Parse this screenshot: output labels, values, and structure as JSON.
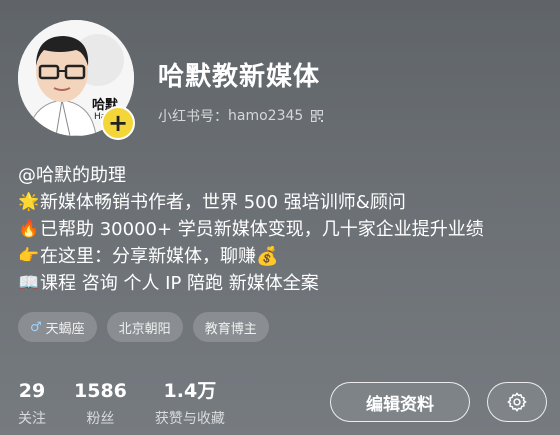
{
  "profile": {
    "name": "哈默教新媒体",
    "id_label": "小红书号：",
    "id_value": "hamo2345",
    "avatar_text": "哈默",
    "avatar_small": "Ha"
  },
  "bio": [
    {
      "icon": "✉",
      "text": "@哈默的助理",
      "icon_name": "none"
    },
    {
      "icon": "🌟",
      "text": "新媒体畅销书作者，世界 500 强培训师&顾问",
      "icon_name": "star-icon"
    },
    {
      "icon": "🔥",
      "text": "已帮助 30000+ 学员新媒体变现，几十家企业提升业绩",
      "icon_name": "fire-icon"
    },
    {
      "icon": "👉",
      "text": "在这里：分享新媒体，聊赚💰",
      "icon_name": "pointing-hand-icon"
    },
    {
      "icon": "📖",
      "text": "课程 咨询 个人 IP 陪跑 新媒体全案",
      "icon_name": "book-icon"
    }
  ],
  "tags": [
    {
      "icon": "♂",
      "label": "天蝎座"
    },
    {
      "label": "北京朝阳"
    },
    {
      "label": "教育博主"
    }
  ],
  "stats": [
    {
      "value": "29",
      "label": "关注"
    },
    {
      "value": "1586",
      "label": "粉丝"
    },
    {
      "value": "1.4万",
      "label": "获赞与收藏"
    }
  ],
  "actions": {
    "edit_label": "编辑资料"
  },
  "colors": {
    "accent_badge": "#f5d63a",
    "background": "#666b70"
  }
}
